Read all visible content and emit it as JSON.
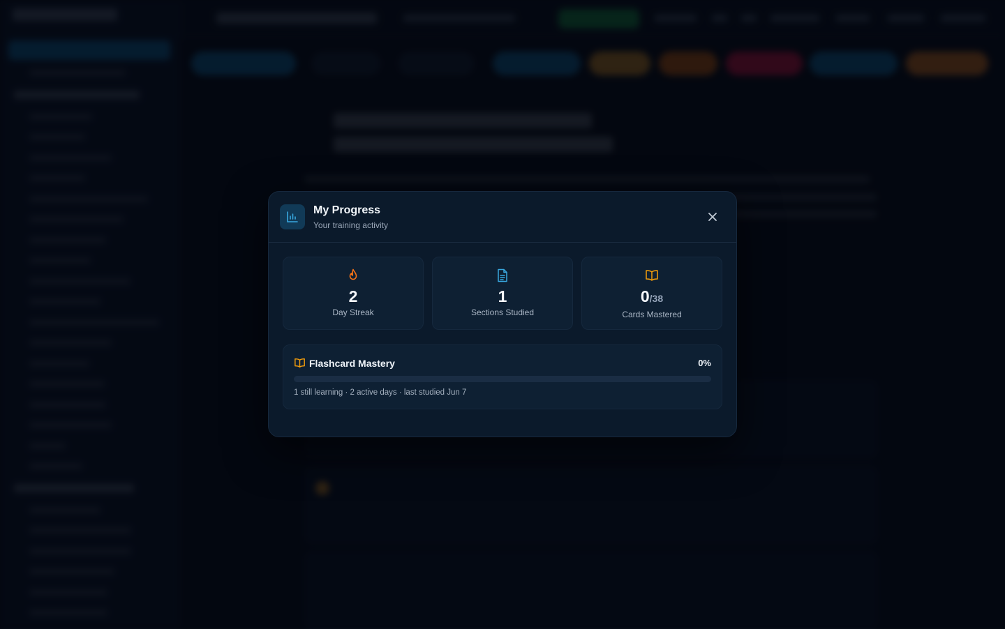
{
  "modal": {
    "title": "My Progress",
    "subtitle": "Your training activity",
    "close_icon": "close-icon",
    "header_icon": "bar-chart-icon",
    "stats": [
      {
        "icon": "flame-icon",
        "icon_color": "#f97316",
        "value": "2",
        "denominator": "",
        "label": "Day Streak"
      },
      {
        "icon": "document-icon",
        "icon_color": "#38a8e0",
        "value": "1",
        "denominator": "",
        "label": "Sections Studied"
      },
      {
        "icon": "book-open-icon",
        "icon_color": "#f59e0b",
        "value": "0",
        "denominator": "/38",
        "label": "Cards Mastered"
      }
    ],
    "mastery": {
      "icon": "book-open-icon",
      "title": "Flashcard Mastery",
      "percent_label": "0%",
      "progress_fraction": 0,
      "meta": "1 still learning · 2 active days · last studied Jun 7"
    }
  },
  "colors": {
    "accent": "#38a8e0",
    "streak": "#f97316",
    "mastery": "#f59e0b",
    "modal_bg": "#0b1a2b"
  }
}
